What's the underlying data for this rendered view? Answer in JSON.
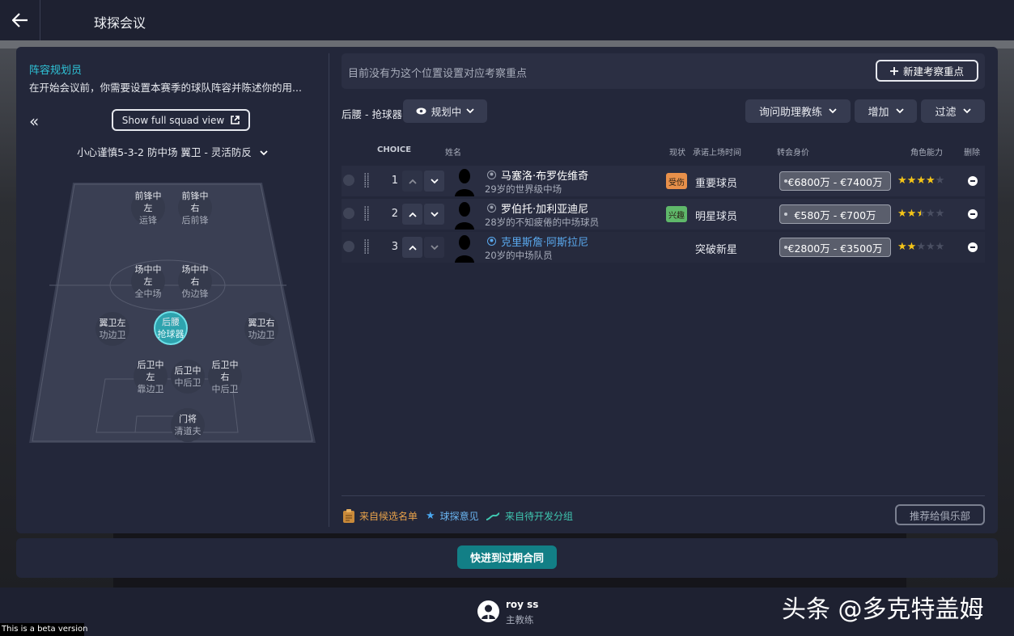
{
  "header": {
    "title": "球探会议"
  },
  "left_panel": {
    "title": "阵容规划员",
    "description": "在开始会议前，你需要设置本赛季的球队阵容并陈述你的用...",
    "squad_button": "Show full squad view",
    "tactic": "小心谨慎5-3-2 防中场 翼卫 - 灵活防反",
    "positions": [
      {
        "name": "前锋中左",
        "role": "运锋"
      },
      {
        "name": "前锋中右",
        "role": "后前锋"
      },
      {
        "name": "场中中左",
        "role": "全中场"
      },
      {
        "name": "场中中右",
        "role": "伪边锋"
      },
      {
        "name": "翼卫左",
        "role": "功边卫"
      },
      {
        "name": "后腰",
        "role": "抢球器"
      },
      {
        "name": "翼卫右",
        "role": "功边卫"
      },
      {
        "name": "后卫中左",
        "role": "靠边卫"
      },
      {
        "name": "后卫中",
        "role": "中后卫"
      },
      {
        "name": "后卫中右",
        "role": "中后卫"
      },
      {
        "name": "门将",
        "role": "清道夫"
      }
    ]
  },
  "right_panel": {
    "notice": "目前没有为这个位置设置对应考察重点",
    "new_focus_button": "新建考察重点",
    "role_label": "后腰 - 抢球器",
    "plan_status": "规划中",
    "ask_coach_button": "询问助理教练",
    "add_button": "增加",
    "filter_button": "过滤",
    "columns": {
      "choice": "CHOICE",
      "name": "姓名",
      "status": "现状",
      "playing_time": "承诺上场时间",
      "value": "转会身价",
      "ability": "角色能力",
      "remove": "删除"
    },
    "players": [
      {
        "choice": "1",
        "name": "马塞洛·布罗佐维奇",
        "desc": "29岁的世界级中场",
        "badge": "受伤",
        "badge_color": "#e8904a",
        "status": "重要球员",
        "value": "€6800万 - €7400万",
        "stars": 4
      },
      {
        "choice": "2",
        "name": "罗伯托·加利亚迪尼",
        "desc": "28岁的不知疲倦的中场球员",
        "badge": "兴趣",
        "badge_color": "#5fb86a",
        "status": "明星球员",
        "value": "€580万 - €700万",
        "stars": 2.5
      },
      {
        "choice": "3",
        "name": "克里斯詹·阿斯拉尼",
        "desc": "20岁的中场队员",
        "badge": "",
        "badge_color": "",
        "status": "突破新星",
        "value": "€2800万 - €3500万",
        "stars": 2
      }
    ],
    "legend": {
      "shortlist": "来自候选名单",
      "scout": "球探意见",
      "dev": "来自待开发分组"
    },
    "recommend_button": "推荐给俱乐部"
  },
  "bottom": {
    "forward_button": "快进到过期合同"
  },
  "footer": {
    "manager_name": "roy ss",
    "manager_role": "主教练",
    "watermark": "头条 @多克特盖姆",
    "beta": "This is a beta version"
  },
  "colors": {
    "accent": "#2fc4d8",
    "star": "#f5c518",
    "primary_btn": "#127f86"
  }
}
